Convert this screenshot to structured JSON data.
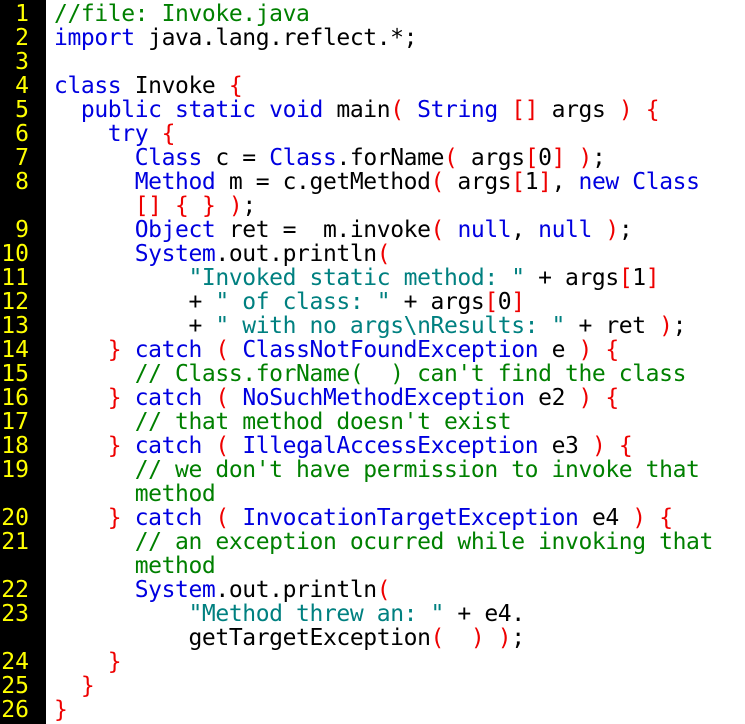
{
  "colors": {
    "gutter_background": "#000000",
    "line_number": "#ffff00",
    "keyword": "#0000e0",
    "bracket": "#ee0000",
    "plain": "#000000",
    "string": "#008080",
    "comment": "#008000",
    "background": "#ffffff"
  },
  "lines": [
    {
      "number": "1",
      "tokens": [
        {
          "t": "cm",
          "s": "//file: Invoke.java"
        }
      ]
    },
    {
      "number": "2",
      "tokens": [
        {
          "t": "kw",
          "s": "import"
        },
        {
          "t": "pl",
          "s": " java.lang.reflect.*;"
        }
      ]
    },
    {
      "number": "3",
      "tokens": []
    },
    {
      "number": "4",
      "tokens": [
        {
          "t": "kw",
          "s": "class"
        },
        {
          "t": "pl",
          "s": " Invoke "
        },
        {
          "t": "br",
          "s": "{"
        }
      ]
    },
    {
      "number": "5",
      "tokens": [
        {
          "t": "pl",
          "s": "  "
        },
        {
          "t": "kw",
          "s": "public static void"
        },
        {
          "t": "pl",
          "s": " main"
        },
        {
          "t": "br",
          "s": "("
        },
        {
          "t": "pl",
          "s": " "
        },
        {
          "t": "kw",
          "s": "String"
        },
        {
          "t": "pl",
          "s": " "
        },
        {
          "t": "br",
          "s": "[]"
        },
        {
          "t": "pl",
          "s": " args "
        },
        {
          "t": "br",
          "s": ")"
        },
        {
          "t": "pl",
          "s": " "
        },
        {
          "t": "br",
          "s": "{"
        }
      ]
    },
    {
      "number": "6",
      "tokens": [
        {
          "t": "pl",
          "s": "    "
        },
        {
          "t": "kw",
          "s": "try"
        },
        {
          "t": "pl",
          "s": " "
        },
        {
          "t": "br",
          "s": "{"
        }
      ]
    },
    {
      "number": "7",
      "tokens": [
        {
          "t": "pl",
          "s": "      "
        },
        {
          "t": "kw",
          "s": "Class"
        },
        {
          "t": "pl",
          "s": " c = "
        },
        {
          "t": "kw",
          "s": "Class"
        },
        {
          "t": "pl",
          "s": ".forName"
        },
        {
          "t": "br",
          "s": "("
        },
        {
          "t": "pl",
          "s": " args"
        },
        {
          "t": "br",
          "s": "["
        },
        {
          "t": "pl",
          "s": "0"
        },
        {
          "t": "br",
          "s": "]"
        },
        {
          "t": "pl",
          "s": " "
        },
        {
          "t": "br",
          "s": ")"
        },
        {
          "t": "pl",
          "s": ";"
        }
      ]
    },
    {
      "number": "8",
      "tokens": [
        {
          "t": "pl",
          "s": "      "
        },
        {
          "t": "kw",
          "s": "Method"
        },
        {
          "t": "pl",
          "s": " m = c.getMethod"
        },
        {
          "t": "br",
          "s": "("
        },
        {
          "t": "pl",
          "s": " args"
        },
        {
          "t": "br",
          "s": "["
        },
        {
          "t": "pl",
          "s": "1"
        },
        {
          "t": "br",
          "s": "]"
        },
        {
          "t": "pl",
          "s": ", "
        },
        {
          "t": "kw",
          "s": "new"
        },
        {
          "t": "pl",
          "s": " "
        },
        {
          "t": "kw",
          "s": "Class"
        }
      ]
    },
    {
      "number": "",
      "tokens": [
        {
          "t": "pl",
          "s": "      "
        },
        {
          "t": "br",
          "s": "[]"
        },
        {
          "t": "pl",
          "s": " "
        },
        {
          "t": "br",
          "s": "{"
        },
        {
          "t": "pl",
          "s": " "
        },
        {
          "t": "br",
          "s": "}"
        },
        {
          "t": "pl",
          "s": " "
        },
        {
          "t": "br",
          "s": ")"
        },
        {
          "t": "pl",
          "s": ";"
        }
      ]
    },
    {
      "number": "9",
      "tokens": [
        {
          "t": "pl",
          "s": "      "
        },
        {
          "t": "kw",
          "s": "Object"
        },
        {
          "t": "pl",
          "s": " ret =  m.invoke"
        },
        {
          "t": "br",
          "s": "("
        },
        {
          "t": "pl",
          "s": " "
        },
        {
          "t": "kw",
          "s": "null"
        },
        {
          "t": "pl",
          "s": ", "
        },
        {
          "t": "kw",
          "s": "null"
        },
        {
          "t": "pl",
          "s": " "
        },
        {
          "t": "br",
          "s": ")"
        },
        {
          "t": "pl",
          "s": ";"
        }
      ]
    },
    {
      "number": "10",
      "tokens": [
        {
          "t": "pl",
          "s": "      "
        },
        {
          "t": "kw",
          "s": "System"
        },
        {
          "t": "pl",
          "s": ".out.println"
        },
        {
          "t": "br",
          "s": "("
        }
      ]
    },
    {
      "number": "11",
      "tokens": [
        {
          "t": "pl",
          "s": "          "
        },
        {
          "t": "st",
          "s": "\"Invoked static method: \""
        },
        {
          "t": "pl",
          "s": " + args"
        },
        {
          "t": "br",
          "s": "["
        },
        {
          "t": "pl",
          "s": "1"
        },
        {
          "t": "br",
          "s": "]"
        }
      ]
    },
    {
      "number": "12",
      "tokens": [
        {
          "t": "pl",
          "s": "          + "
        },
        {
          "t": "st",
          "s": "\" of class: \""
        },
        {
          "t": "pl",
          "s": " + args"
        },
        {
          "t": "br",
          "s": "["
        },
        {
          "t": "pl",
          "s": "0"
        },
        {
          "t": "br",
          "s": "]"
        }
      ]
    },
    {
      "number": "13",
      "tokens": [
        {
          "t": "pl",
          "s": "          + "
        },
        {
          "t": "st",
          "s": "\" with no args\\nResults: \""
        },
        {
          "t": "pl",
          "s": " + ret "
        },
        {
          "t": "br",
          "s": ")"
        },
        {
          "t": "pl",
          "s": ";"
        }
      ]
    },
    {
      "number": "14",
      "tokens": [
        {
          "t": "pl",
          "s": "    "
        },
        {
          "t": "br",
          "s": "}"
        },
        {
          "t": "pl",
          "s": " "
        },
        {
          "t": "kw",
          "s": "catch"
        },
        {
          "t": "pl",
          "s": " "
        },
        {
          "t": "br",
          "s": "("
        },
        {
          "t": "pl",
          "s": " "
        },
        {
          "t": "kw",
          "s": "ClassNotFoundException"
        },
        {
          "t": "pl",
          "s": " e "
        },
        {
          "t": "br",
          "s": ")"
        },
        {
          "t": "pl",
          "s": " "
        },
        {
          "t": "br",
          "s": "{"
        }
      ]
    },
    {
      "number": "15",
      "tokens": [
        {
          "t": "pl",
          "s": "      "
        },
        {
          "t": "cm",
          "s": "// Class.forName(  ) can't find the class"
        }
      ]
    },
    {
      "number": "16",
      "tokens": [
        {
          "t": "pl",
          "s": "    "
        },
        {
          "t": "br",
          "s": "}"
        },
        {
          "t": "pl",
          "s": " "
        },
        {
          "t": "kw",
          "s": "catch"
        },
        {
          "t": "pl",
          "s": " "
        },
        {
          "t": "br",
          "s": "("
        },
        {
          "t": "pl",
          "s": " "
        },
        {
          "t": "kw",
          "s": "NoSuchMethodException"
        },
        {
          "t": "pl",
          "s": " e2 "
        },
        {
          "t": "br",
          "s": ")"
        },
        {
          "t": "pl",
          "s": " "
        },
        {
          "t": "br",
          "s": "{"
        }
      ]
    },
    {
      "number": "17",
      "tokens": [
        {
          "t": "pl",
          "s": "      "
        },
        {
          "t": "cm",
          "s": "// that method doesn't exist"
        }
      ]
    },
    {
      "number": "18",
      "tokens": [
        {
          "t": "pl",
          "s": "    "
        },
        {
          "t": "br",
          "s": "}"
        },
        {
          "t": "pl",
          "s": " "
        },
        {
          "t": "kw",
          "s": "catch"
        },
        {
          "t": "pl",
          "s": " "
        },
        {
          "t": "br",
          "s": "("
        },
        {
          "t": "pl",
          "s": " "
        },
        {
          "t": "kw",
          "s": "IllegalAccessException"
        },
        {
          "t": "pl",
          "s": " e3 "
        },
        {
          "t": "br",
          "s": ")"
        },
        {
          "t": "pl",
          "s": " "
        },
        {
          "t": "br",
          "s": "{"
        }
      ]
    },
    {
      "number": "19",
      "tokens": [
        {
          "t": "pl",
          "s": "      "
        },
        {
          "t": "cm",
          "s": "// we don't have permission to invoke that"
        }
      ]
    },
    {
      "number": "",
      "tokens": [
        {
          "t": "pl",
          "s": "      "
        },
        {
          "t": "cm",
          "s": "method"
        }
      ]
    },
    {
      "number": "20",
      "tokens": [
        {
          "t": "pl",
          "s": "    "
        },
        {
          "t": "br",
          "s": "}"
        },
        {
          "t": "pl",
          "s": " "
        },
        {
          "t": "kw",
          "s": "catch"
        },
        {
          "t": "pl",
          "s": " "
        },
        {
          "t": "br",
          "s": "("
        },
        {
          "t": "pl",
          "s": " "
        },
        {
          "t": "kw",
          "s": "InvocationTargetException"
        },
        {
          "t": "pl",
          "s": " e4 "
        },
        {
          "t": "br",
          "s": ")"
        },
        {
          "t": "pl",
          "s": " "
        },
        {
          "t": "br",
          "s": "{"
        }
      ]
    },
    {
      "number": "21",
      "tokens": [
        {
          "t": "pl",
          "s": "      "
        },
        {
          "t": "cm",
          "s": "// an exception ocurred while invoking that"
        }
      ]
    },
    {
      "number": "",
      "tokens": [
        {
          "t": "pl",
          "s": "      "
        },
        {
          "t": "cm",
          "s": "method"
        }
      ]
    },
    {
      "number": "22",
      "tokens": [
        {
          "t": "pl",
          "s": "      "
        },
        {
          "t": "kw",
          "s": "System"
        },
        {
          "t": "pl",
          "s": ".out.println"
        },
        {
          "t": "br",
          "s": "("
        }
      ]
    },
    {
      "number": "23",
      "tokens": [
        {
          "t": "pl",
          "s": "          "
        },
        {
          "t": "st",
          "s": "\"Method threw an: \""
        },
        {
          "t": "pl",
          "s": " + e4."
        }
      ]
    },
    {
      "number": "",
      "tokens": [
        {
          "t": "pl",
          "s": "          getTargetException"
        },
        {
          "t": "br",
          "s": "("
        },
        {
          "t": "pl",
          "s": "  "
        },
        {
          "t": "br",
          "s": ")"
        },
        {
          "t": "pl",
          "s": " "
        },
        {
          "t": "br",
          "s": ")"
        },
        {
          "t": "pl",
          "s": ";"
        }
      ]
    },
    {
      "number": "24",
      "tokens": [
        {
          "t": "pl",
          "s": "    "
        },
        {
          "t": "br",
          "s": "}"
        }
      ]
    },
    {
      "number": "25",
      "tokens": [
        {
          "t": "pl",
          "s": "  "
        },
        {
          "t": "br",
          "s": "}"
        }
      ]
    },
    {
      "number": "26",
      "tokens": [
        {
          "t": "br",
          "s": "}"
        }
      ]
    }
  ]
}
